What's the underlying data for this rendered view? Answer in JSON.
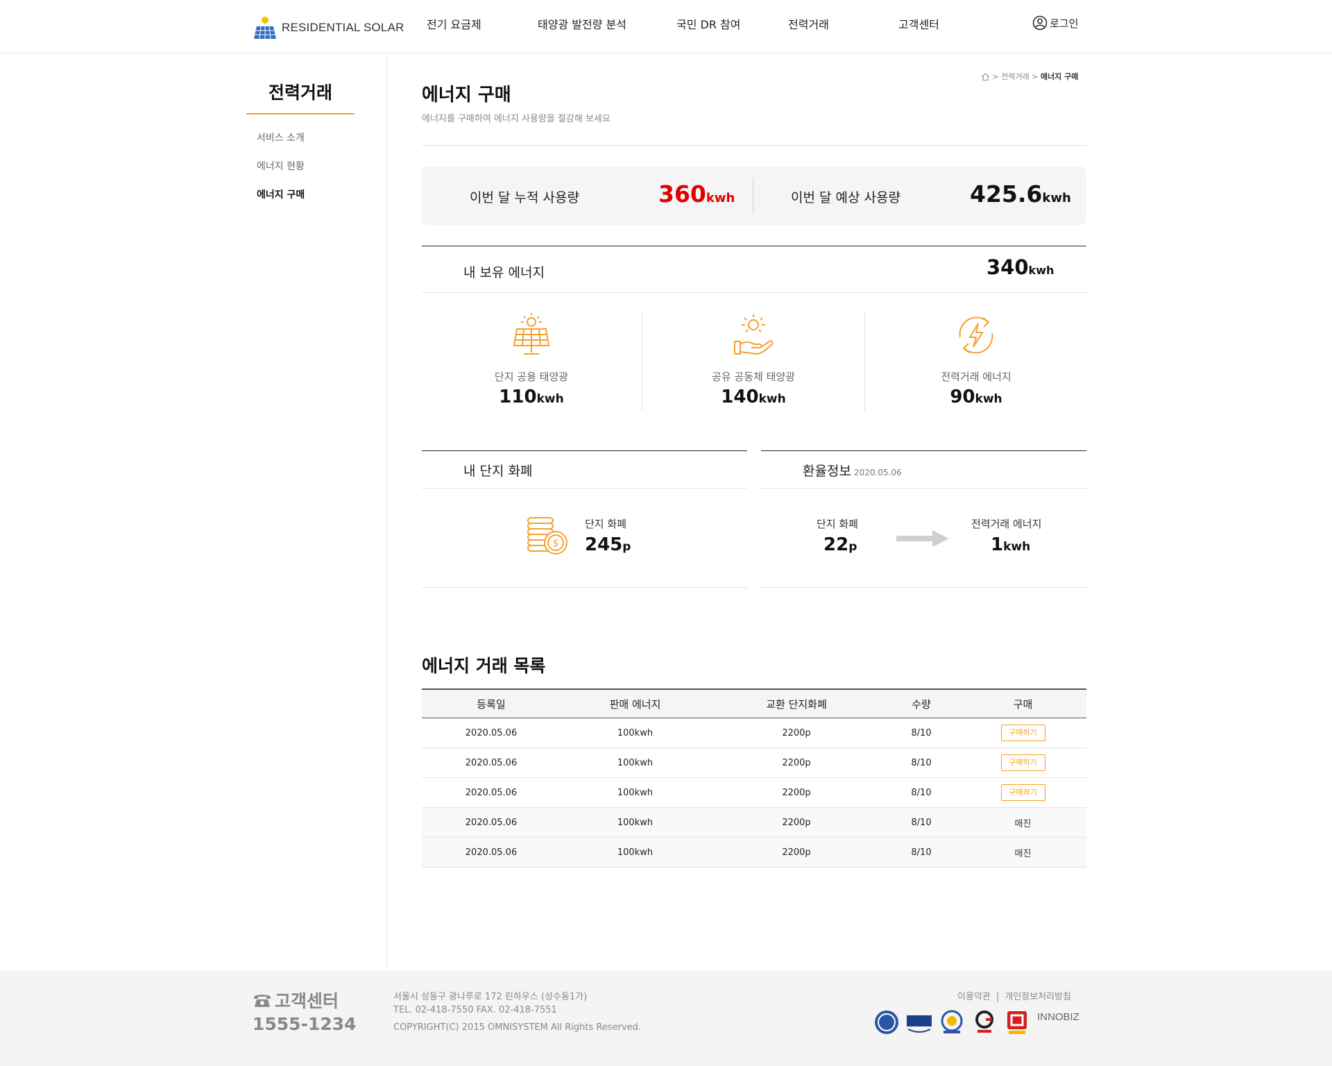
{
  "header": {
    "logo_text": "RESIDENTIAL SOLAR",
    "nav": [
      "전기 요금제",
      "태양광 발전량 분석",
      "국민 DR 참여",
      "전력거래",
      "고객센터"
    ],
    "login": "로그인"
  },
  "sidebar": {
    "title": "전력거래",
    "items": [
      {
        "label": "서비스 소개"
      },
      {
        "label": "에너지 현황"
      },
      {
        "label": "에너지 구매"
      }
    ]
  },
  "breadcrumb": {
    "parent": "전력거래",
    "current": "에너지 구매"
  },
  "page": {
    "title": "에너지 구매",
    "desc": "에너지를 구매하여 에너지 사용량을 절감해 보세요"
  },
  "usage": {
    "current_label": "이번 달 누적 사용량",
    "current_value": "360",
    "expected_label": "이번 달 예상 사용량",
    "expected_value": "425.6",
    "unit": "kwh"
  },
  "own_energy": {
    "label": "내 보유 에너지",
    "value": "340",
    "unit": "kwh",
    "sources": [
      {
        "label": "단지 공용 태양광",
        "value": "110",
        "unit": "kwh",
        "icon": "solar-panel-icon"
      },
      {
        "label": "공유 공동체 태양광",
        "value": "140",
        "unit": "kwh",
        "icon": "sun-hand-icon"
      },
      {
        "label": "전력거래 에너지",
        "value": "90",
        "unit": "kwh",
        "icon": "energy-exchange-icon"
      }
    ]
  },
  "currency": {
    "section_label": "내 단지 화폐",
    "label": "단지 화폐",
    "value": "245",
    "unit": "p"
  },
  "exchange": {
    "section_label": "환율정보",
    "date": "2020.05.06",
    "from_label": "단지 화폐",
    "from_value": "22",
    "from_unit": "p",
    "to_label": "전력거래 에너지",
    "to_value": "1",
    "to_unit": "kwh"
  },
  "trade_list": {
    "title": "에너지 거래 목록",
    "columns": [
      "등록일",
      "판매 에너지",
      "교환 단지화폐",
      "수량",
      "구매"
    ],
    "rows": [
      {
        "date": "2020.05.06",
        "energy": "100kwh",
        "price": "2200p",
        "qty": "8/10",
        "action": "구매하기",
        "sold_out": false
      },
      {
        "date": "2020.05.06",
        "energy": "100kwh",
        "price": "2200p",
        "qty": "8/10",
        "action": "구매하기",
        "sold_out": false
      },
      {
        "date": "2020.05.06",
        "energy": "100kwh",
        "price": "2200p",
        "qty": "8/10",
        "action": "구매하기",
        "sold_out": false
      },
      {
        "date": "2020.05.06",
        "energy": "100kwh",
        "price": "2200p",
        "qty": "8/10",
        "action": "매진",
        "sold_out": true
      },
      {
        "date": "2020.05.06",
        "energy": "100kwh",
        "price": "2200p",
        "qty": "8/10",
        "action": "매진",
        "sold_out": true
      }
    ]
  },
  "footer": {
    "cs_title": "고객센터",
    "cs_phone": "1555-1234",
    "address": "서울시 성동구 광나루로 172 린하우스 (성수동1가)",
    "tel": "TEL. 02-418-7550  FAX. 02-418-7551",
    "copyright": "COPYRIGHT(C) 2015 OMNISYSTEM All Rights Reserved.",
    "terms": "이용약관",
    "privacy": "개인정보처리방침",
    "innobiz": "INNOBIZ"
  },
  "colors": {
    "accent": "#f2a31b",
    "highlight_red": "#e00000",
    "icon_orange": "#f5a030"
  }
}
